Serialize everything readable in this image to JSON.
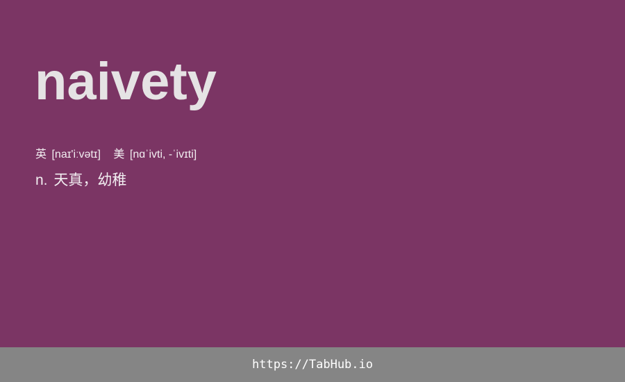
{
  "theme": {
    "background": "#7b3564",
    "text": "#e5e3e4",
    "footer_background": "#858585",
    "footer_text": "#ffffff"
  },
  "card": {
    "word": "naivety",
    "phonetics": [
      {
        "label": "英",
        "ipa": "[naɪ'iːvətɪ]"
      },
      {
        "label": "美",
        "ipa": "[nɑˈivti, -ˈivɪti]"
      }
    ],
    "definition": {
      "part_of_speech": "n.",
      "meaning": "天真，幼稚"
    }
  },
  "footer": {
    "link_text": "https://TabHub.io"
  }
}
